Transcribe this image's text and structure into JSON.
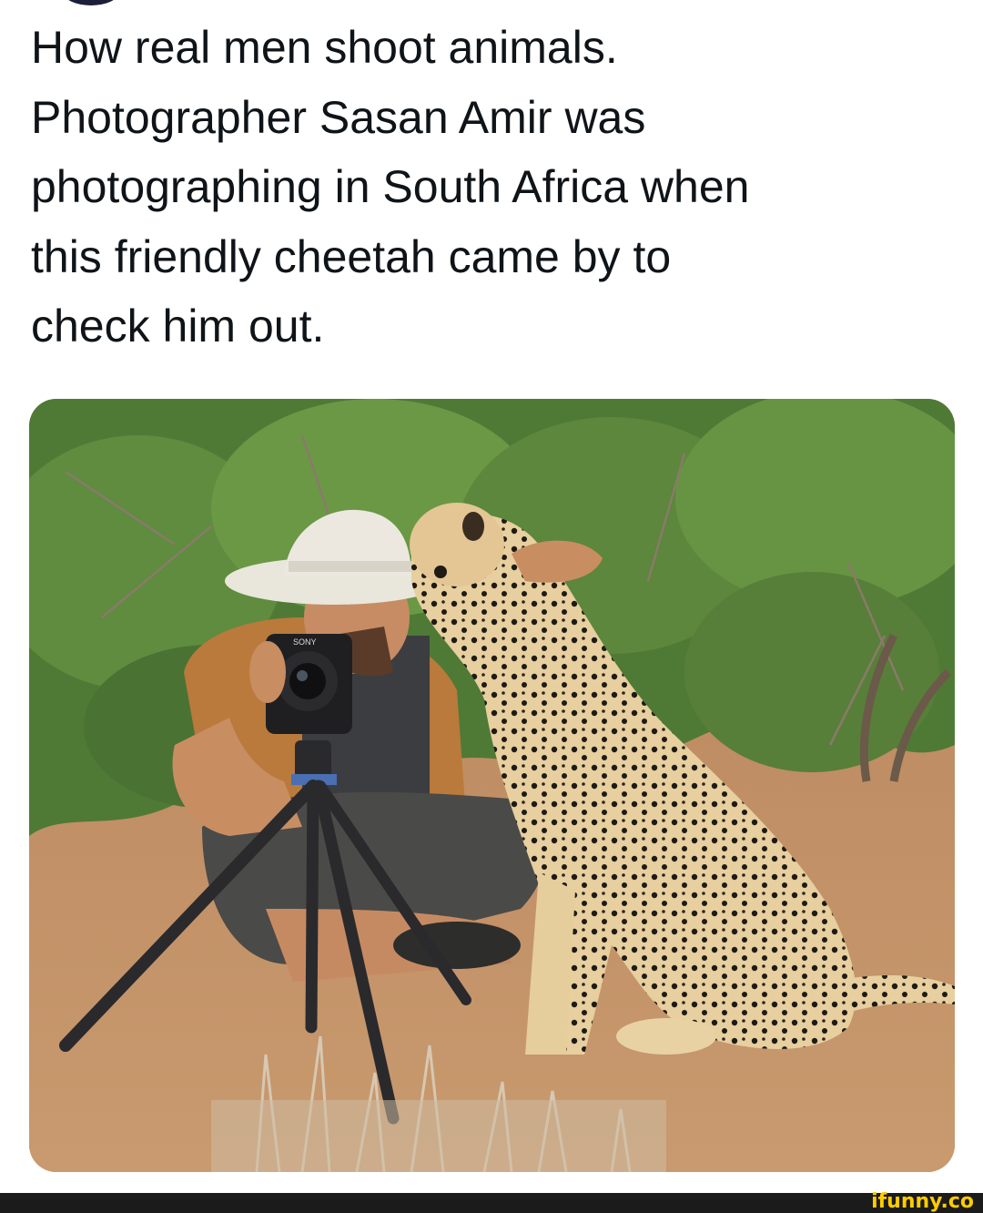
{
  "post": {
    "text_lines": [
      "How real men shoot animals.",
      "Photographer Sasan Amir was",
      "photographing in South Africa when",
      "this friendly cheetah came by to",
      "check him out."
    ]
  },
  "media": {
    "subject": "photographer-with-cheetah-photo",
    "camera_brand_text": "SONY"
  },
  "footer": {
    "watermark": "ifunny.co",
    "bar_color": "#1b1b1b",
    "logo_color": "#ffcc00"
  }
}
